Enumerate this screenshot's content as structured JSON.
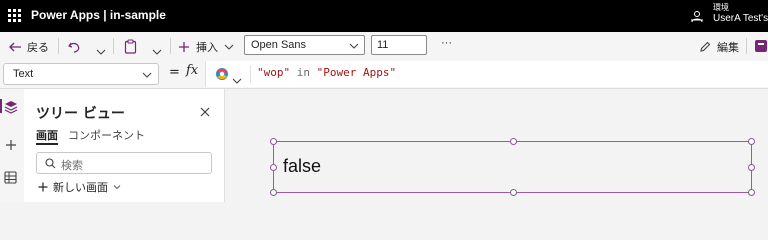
{
  "header": {
    "app_title": "Power Apps  |  in-sample",
    "env_label": "環境",
    "user_label": "UserA Test's"
  },
  "toolbar": {
    "back_label": "戻る",
    "insert_label": "挿入",
    "font_family": "Open Sans",
    "font_size": "11",
    "more_label": "···",
    "edit_label": "編集"
  },
  "formula_bar": {
    "property": "Text",
    "fx_label": "fx",
    "formula_string1": "\"wop\"",
    "formula_keyword": " in ",
    "formula_string2": "\"Power Apps\""
  },
  "tree": {
    "title": "ツリー ビュー",
    "tab_screens": "画面",
    "tab_components": "コンポーネント",
    "search_placeholder": "検索",
    "new_screen_label": "新しい画面"
  },
  "canvas": {
    "label_text": "false"
  },
  "colors": {
    "accent": "#742774",
    "selection": "#9b59a8",
    "string": "#a31515"
  }
}
